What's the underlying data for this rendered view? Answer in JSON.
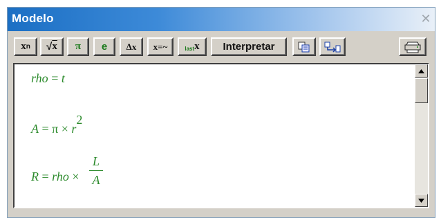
{
  "window": {
    "title": "Modelo"
  },
  "toolbar": {
    "power_base": "x",
    "power_exp": "n",
    "sqrt_arg": "x",
    "pi_label": "π",
    "e_label": "e",
    "delta_label": "Δx",
    "approx_label": "x=~",
    "last_sub": "last",
    "last_base": "x",
    "interpret_label": "Interpretar"
  },
  "editor": {
    "eq1": {
      "lhs": "rho",
      "eq": "=",
      "rhs": "t"
    },
    "eq2": {
      "lhs": "A",
      "eq": "=",
      "pi": "π",
      "times": "×",
      "var": "r",
      "exp": "2"
    },
    "eq3": {
      "lhs": "R",
      "eq": "=",
      "var": "rho",
      "times": "×",
      "num": "L",
      "den": "A"
    }
  },
  "icons": [
    "close-icon",
    "copy-icon",
    "export-icon",
    "printer-icon",
    "arrow-up-icon",
    "arrow-down-icon"
  ]
}
